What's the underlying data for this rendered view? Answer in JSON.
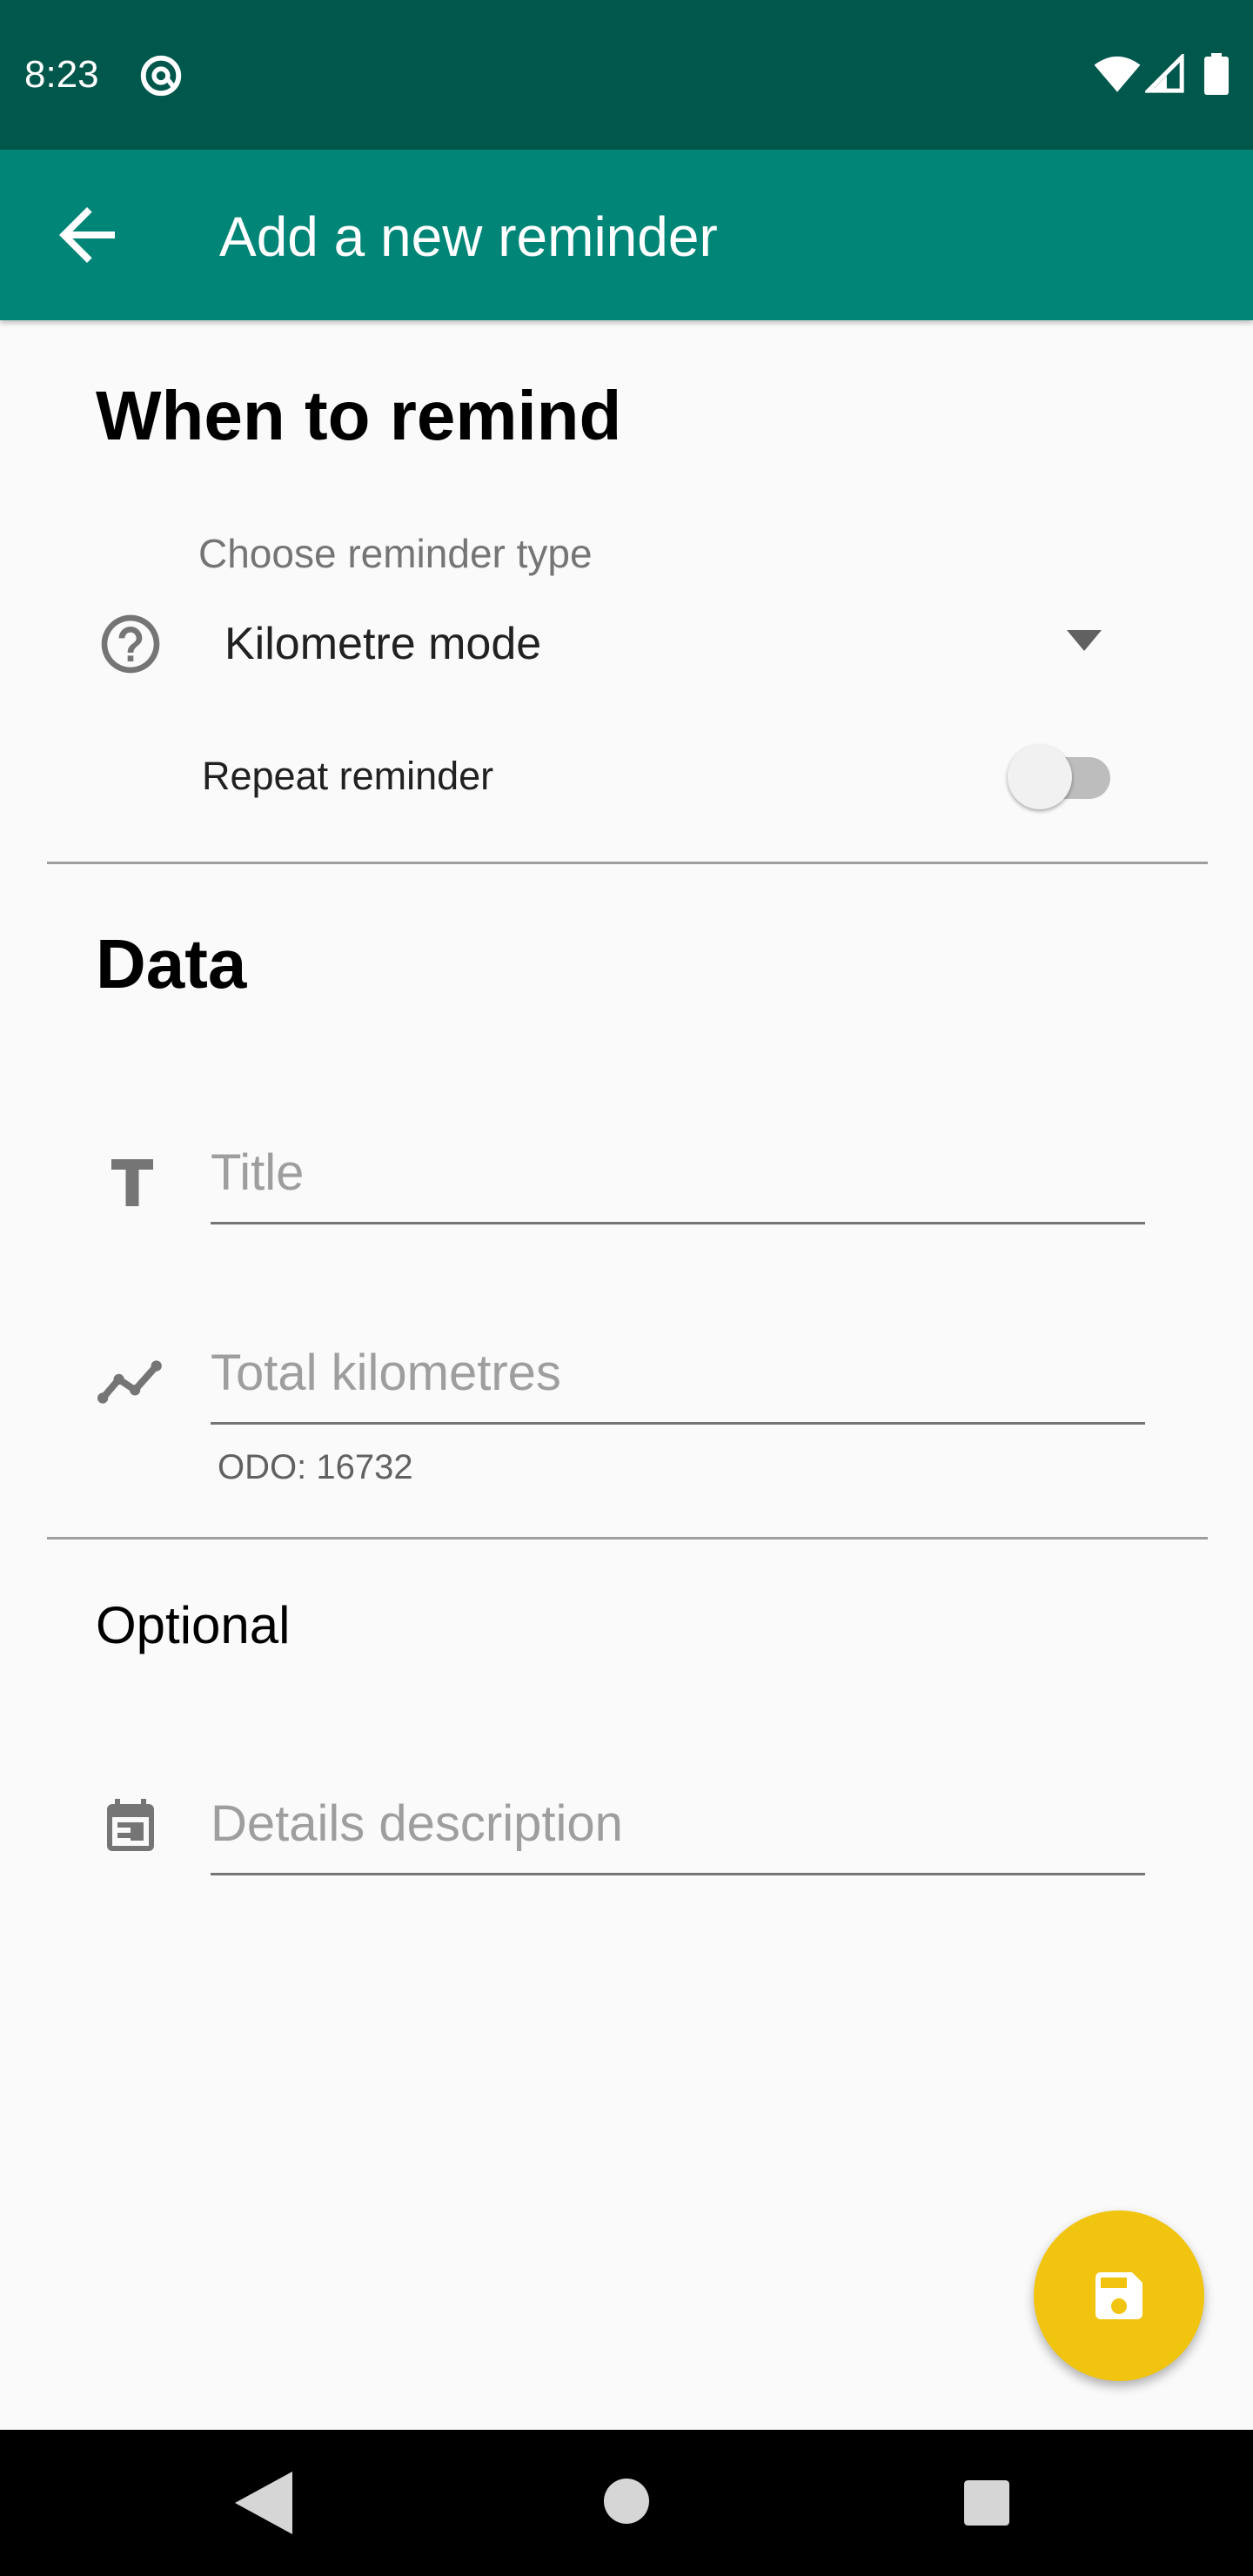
{
  "status_bar": {
    "time": "8:23"
  },
  "app_bar": {
    "title": "Add a new reminder"
  },
  "when_section": {
    "heading": "When to remind",
    "type_label": "Choose reminder type",
    "type_value": "Kilometre mode",
    "repeat_label": "Repeat reminder",
    "repeat_on": false
  },
  "data_section": {
    "heading": "Data",
    "title_placeholder": "Title",
    "km_placeholder": "Total kilometres",
    "odo_helper": "ODO: 16732"
  },
  "optional_section": {
    "heading": "Optional",
    "details_placeholder": "Details description"
  },
  "icons": {
    "help": "help-circle-icon",
    "title": "text-icon",
    "km": "trend-line-icon",
    "details": "calendar-icon",
    "fab": "save-icon"
  },
  "colors": {
    "status_bar": "#00574b",
    "app_bar": "#008577",
    "fab": "#f1c40f"
  }
}
